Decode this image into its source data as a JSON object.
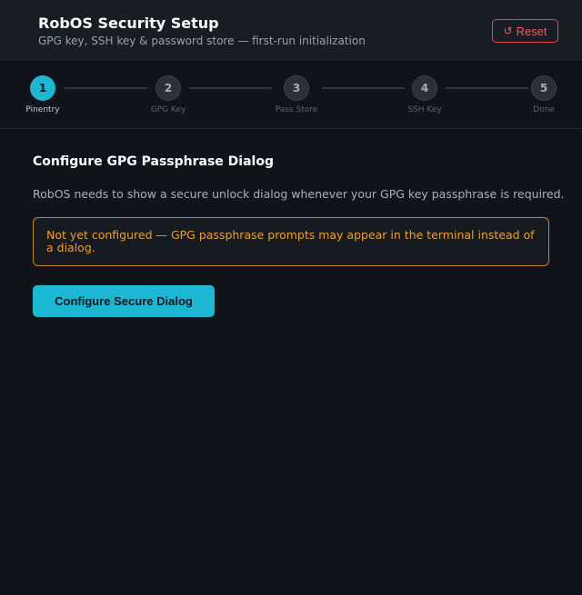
{
  "header": {
    "title": "RobOS Security Setup",
    "subtitle": "GPG key, SSH key & password store — first-run initialization",
    "reset_icon": "↺",
    "reset_label": "Reset"
  },
  "stepper": {
    "current_step": 1,
    "steps": [
      {
        "number": "1",
        "label": "Pinentry",
        "state": "active"
      },
      {
        "number": "2",
        "label": "GPG Key",
        "state": "pending"
      },
      {
        "number": "3",
        "label": "Pass Store",
        "state": "pending"
      },
      {
        "number": "4",
        "label": "SSH Key",
        "state": "pending"
      },
      {
        "number": "5",
        "label": "Done",
        "state": "pending"
      }
    ]
  },
  "main": {
    "title": "Configure GPG Passphrase Dialog",
    "description": "RobOS needs to show a secure unlock dialog whenever your GPG key passphrase is required.",
    "warning": "Not yet configured — GPG passphrase prompts may appear in the terminal instead of a dialog.",
    "primary_button": "Configure Secure Dialog"
  },
  "colors": {
    "background": "#10131a",
    "header_background": "#181c23",
    "accent": "#1cb8d3",
    "danger": "#e5484d",
    "warning": "#f0a020"
  }
}
